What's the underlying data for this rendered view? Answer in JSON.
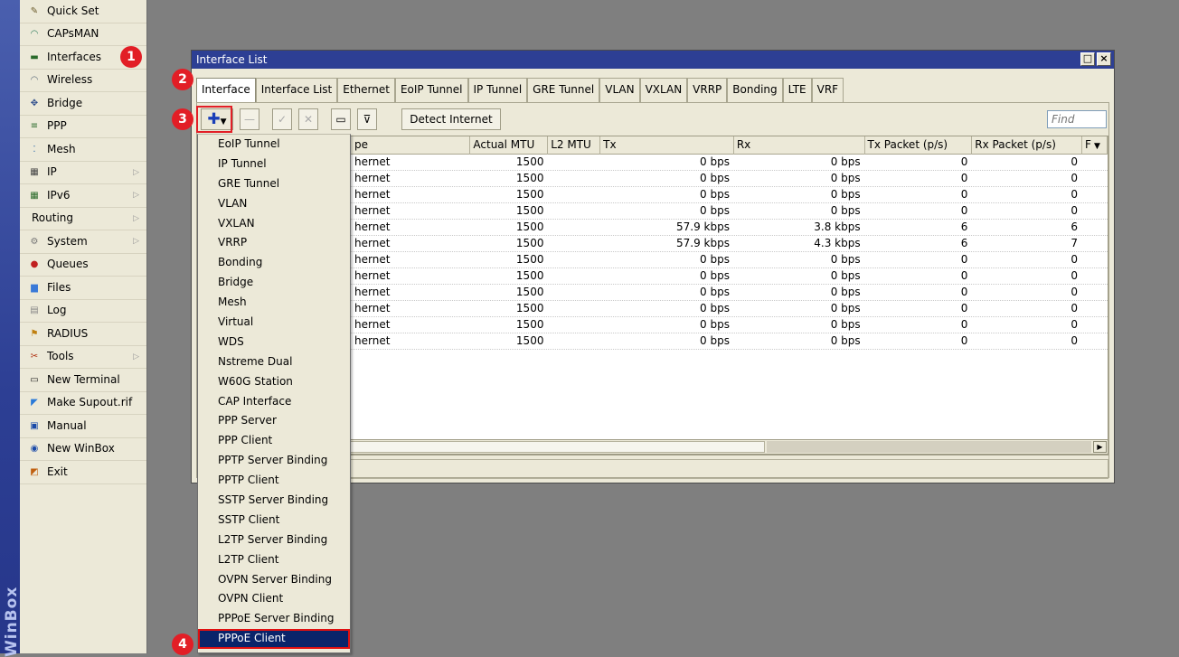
{
  "brand": {
    "vertical_text": "WinBox"
  },
  "side_menu": {
    "items": [
      {
        "label": "Quick Set",
        "icon": "wand-icon",
        "submenu": false
      },
      {
        "label": "CAPsMAN",
        "icon": "capsman-icon",
        "submenu": false
      },
      {
        "label": "Interfaces",
        "icon": "interfaces-icon",
        "submenu": false
      },
      {
        "label": "Wireless",
        "icon": "wireless-icon",
        "submenu": false
      },
      {
        "label": "Bridge",
        "icon": "bridge-icon",
        "submenu": false
      },
      {
        "label": "PPP",
        "icon": "ppp-icon",
        "submenu": false
      },
      {
        "label": "Mesh",
        "icon": "mesh-icon",
        "submenu": false
      },
      {
        "label": "IP",
        "icon": "ip-icon",
        "submenu": true
      },
      {
        "label": "IPv6",
        "icon": "ipv6-icon",
        "submenu": true
      },
      {
        "label": "Routing",
        "icon": "",
        "submenu": true
      },
      {
        "label": "System",
        "icon": "gear-icon",
        "submenu": true
      },
      {
        "label": "Queues",
        "icon": "queues-icon",
        "submenu": false
      },
      {
        "label": "Files",
        "icon": "folder-icon",
        "submenu": false
      },
      {
        "label": "Log",
        "icon": "log-icon",
        "submenu": false
      },
      {
        "label": "RADIUS",
        "icon": "radius-icon",
        "submenu": false
      },
      {
        "label": "Tools",
        "icon": "tools-icon",
        "submenu": true
      },
      {
        "label": "New Terminal",
        "icon": "terminal-icon",
        "submenu": false
      },
      {
        "label": "Make Supout.rif",
        "icon": "supout-icon",
        "submenu": false
      },
      {
        "label": "Manual",
        "icon": "manual-icon",
        "submenu": false
      },
      {
        "label": "New WinBox",
        "icon": "winbox-icon",
        "submenu": false
      },
      {
        "label": "Exit",
        "icon": "exit-icon",
        "submenu": false
      }
    ]
  },
  "window": {
    "title": "Interface List",
    "tabs": [
      "Interface",
      "Interface List",
      "Ethernet",
      "EoIP Tunnel",
      "IP Tunnel",
      "GRE Tunnel",
      "VLAN",
      "VXLAN",
      "VRRP",
      "Bonding",
      "LTE",
      "VRF"
    ],
    "active_tab": "Interface",
    "toolbar": {
      "detect_internet_label": "Detect Internet",
      "find_placeholder": "Find"
    },
    "table": {
      "columns": [
        "pe",
        "Actual MTU",
        "L2 MTU",
        "Tx",
        "Rx",
        "Tx Packet (p/s)",
        "Rx Packet (p/s)",
        "F"
      ],
      "rows": [
        {
          "type": "hernet",
          "mtu": "1500",
          "l2": "",
          "tx": "0 bps",
          "rx": "0 bps",
          "txp": "0",
          "rxp": "0"
        },
        {
          "type": "hernet",
          "mtu": "1500",
          "l2": "",
          "tx": "0 bps",
          "rx": "0 bps",
          "txp": "0",
          "rxp": "0"
        },
        {
          "type": "hernet",
          "mtu": "1500",
          "l2": "",
          "tx": "0 bps",
          "rx": "0 bps",
          "txp": "0",
          "rxp": "0"
        },
        {
          "type": "hernet",
          "mtu": "1500",
          "l2": "",
          "tx": "0 bps",
          "rx": "0 bps",
          "txp": "0",
          "rxp": "0"
        },
        {
          "type": "hernet",
          "mtu": "1500",
          "l2": "",
          "tx": "57.9 kbps",
          "rx": "3.8 kbps",
          "txp": "6",
          "rxp": "6"
        },
        {
          "type": "hernet",
          "mtu": "1500",
          "l2": "",
          "tx": "57.9 kbps",
          "rx": "4.3 kbps",
          "txp": "6",
          "rxp": "7"
        },
        {
          "type": "hernet",
          "mtu": "1500",
          "l2": "",
          "tx": "0 bps",
          "rx": "0 bps",
          "txp": "0",
          "rxp": "0"
        },
        {
          "type": "hernet",
          "mtu": "1500",
          "l2": "",
          "tx": "0 bps",
          "rx": "0 bps",
          "txp": "0",
          "rxp": "0"
        },
        {
          "type": "hernet",
          "mtu": "1500",
          "l2": "",
          "tx": "0 bps",
          "rx": "0 bps",
          "txp": "0",
          "rxp": "0"
        },
        {
          "type": "hernet",
          "mtu": "1500",
          "l2": "",
          "tx": "0 bps",
          "rx": "0 bps",
          "txp": "0",
          "rxp": "0"
        },
        {
          "type": "hernet",
          "mtu": "1500",
          "l2": "",
          "tx": "0 bps",
          "rx": "0 bps",
          "txp": "0",
          "rxp": "0"
        },
        {
          "type": "hernet",
          "mtu": "1500",
          "l2": "",
          "tx": "0 bps",
          "rx": "0 bps",
          "txp": "0",
          "rxp": "0"
        }
      ]
    }
  },
  "add_menu": {
    "items": [
      "EoIP Tunnel",
      "IP Tunnel",
      "GRE Tunnel",
      "VLAN",
      "VXLAN",
      "VRRP",
      "Bonding",
      "Bridge",
      "Mesh",
      "Virtual",
      "WDS",
      "Nstreme Dual",
      "W60G Station",
      "CAP Interface",
      "PPP Server",
      "PPP Client",
      "PPTP Server Binding",
      "PPTP Client",
      "SSTP Server Binding",
      "SSTP Client",
      "L2TP Server Binding",
      "L2TP Client",
      "OVPN Server Binding",
      "OVPN Client",
      "PPPoE Server Binding",
      "PPPoE Client"
    ],
    "selected": "PPPoE Client"
  },
  "annotations": {
    "step1": "1",
    "step2": "2",
    "step3": "3",
    "step4": "4",
    "color": "#e21e26"
  }
}
